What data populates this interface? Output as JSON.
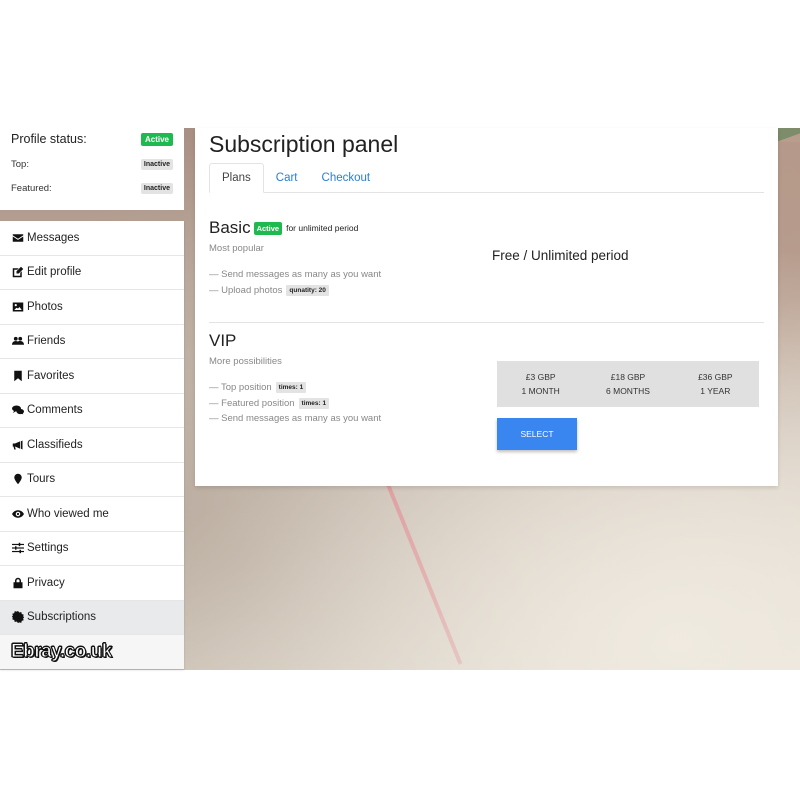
{
  "profile_status": {
    "label": "Profile status:",
    "value": "Active",
    "top": {
      "label": "Top:",
      "value": "Inactive"
    },
    "featured": {
      "label": "Featured:",
      "value": "Inactive"
    }
  },
  "sidebar": {
    "items": [
      {
        "label": "Messages",
        "icon": "envelope-icon"
      },
      {
        "label": "Edit profile",
        "icon": "edit-icon"
      },
      {
        "label": "Photos",
        "icon": "image-icon"
      },
      {
        "label": "Friends",
        "icon": "users-icon"
      },
      {
        "label": "Favorites",
        "icon": "bookmark-icon"
      },
      {
        "label": "Comments",
        "icon": "comments-icon"
      },
      {
        "label": "Classifieds",
        "icon": "megaphone-icon"
      },
      {
        "label": "Tours",
        "icon": "map-marker-icon"
      },
      {
        "label": "Who viewed me",
        "icon": "eye-icon"
      },
      {
        "label": "Settings",
        "icon": "sliders-icon"
      },
      {
        "label": "Privacy",
        "icon": "lock-icon"
      },
      {
        "label": "Subscriptions",
        "icon": "certificate-icon",
        "active": true
      }
    ],
    "brand": "Ebray.co.uk"
  },
  "panel": {
    "title": "Subscription panel",
    "tabs": [
      {
        "label": "Plans",
        "active": true
      },
      {
        "label": "Cart"
      },
      {
        "label": "Checkout"
      }
    ],
    "plans": {
      "basic": {
        "name": "Basic",
        "status": "Active",
        "period": "for unlimited period",
        "subtitle": "Most popular",
        "features": [
          {
            "text": "— Send messages as many as you want"
          },
          {
            "text": "— Upload photos",
            "tag": "qunatity: 20"
          }
        ],
        "price_label": "Free / Unlimited period"
      },
      "vip": {
        "name": "VIP",
        "subtitle": "More possibilities",
        "features": [
          {
            "text": "— Top position",
            "tag": "times: 1"
          },
          {
            "text": "— Featured position",
            "tag": "times: 1"
          },
          {
            "text": "— Send messages as many as you want"
          }
        ],
        "prices": [
          {
            "price": "£3 GBP",
            "duration": "1 MONTH"
          },
          {
            "price": "£18 GBP",
            "duration": "6 MONTHS"
          },
          {
            "price": "£36 GBP",
            "duration": "1 YEAR"
          }
        ],
        "select_label": "SELECT"
      }
    }
  },
  "colors": {
    "active_badge": "#1fba4f",
    "link": "#2a7fd4",
    "select_button": "#3a86f0",
    "price_grid_bg": "#e0e0e0"
  }
}
